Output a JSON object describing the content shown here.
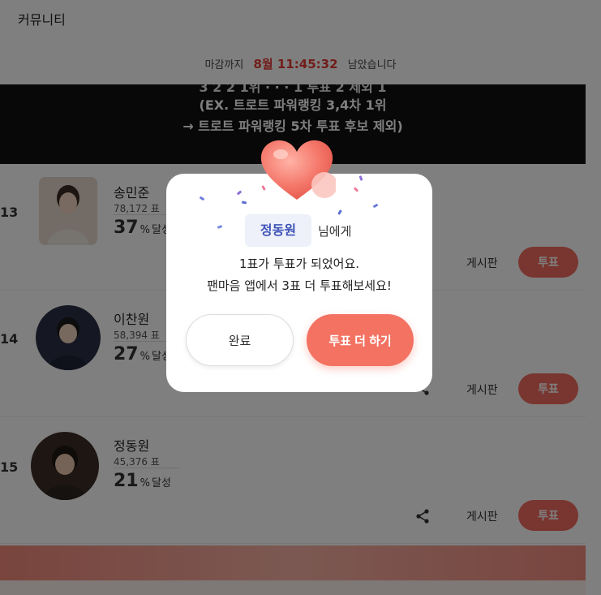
{
  "header": {
    "title": "커뮤니티"
  },
  "deadline": {
    "prefix": "마감까지",
    "time": "8월 11:45:32",
    "suffix": "남았습니다"
  },
  "banner": {
    "line0": "3 2 2 1위 · · · 1 투표 2 제외 1",
    "line1": "(EX. 트로트 파워랭킹 3,4차 1위",
    "line2": "→ 트로트 파워랭킹 5차 투표 후보 제외)"
  },
  "ranking": [
    {
      "rank": "13",
      "name": "송민준",
      "votes": "78,172 표",
      "percent": "37",
      "percent_unit": "%",
      "achieved": "달성",
      "board_label": "게시판",
      "vote_label": "투표"
    },
    {
      "rank": "14",
      "name": "이찬원",
      "votes": "58,394 표",
      "percent": "27",
      "percent_unit": "%",
      "achieved": "달성",
      "board_label": "게시판",
      "vote_label": "투표"
    },
    {
      "rank": "15",
      "name": "정동원",
      "votes": "45,376 표",
      "percent": "21",
      "percent_unit": "%",
      "achieved": "달성",
      "board_label": "게시판",
      "vote_label": "투표"
    }
  ],
  "modal": {
    "recipient": "정동원",
    "recipient_suffix": "님에게",
    "line1": "1표가 투표가 되었어요.",
    "line2": "팬마음 앱에서 3표 더 투표해보세요!",
    "done_label": "완료",
    "more_label": "투표 더 하기"
  },
  "icons": {
    "heart": "heart-icon",
    "share": "share-icon"
  },
  "colors": {
    "accent": "#f36b5e",
    "recipient_text": "#3f54b8",
    "deadline_time": "#e23b35"
  }
}
